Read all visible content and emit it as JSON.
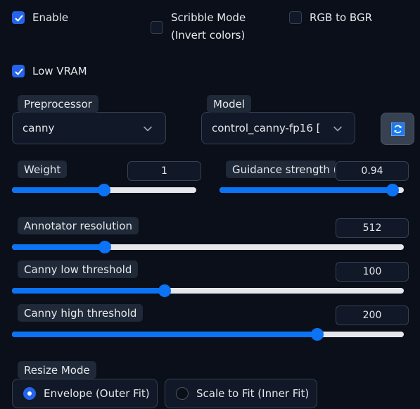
{
  "checkboxes": {
    "enable": {
      "label": "Enable",
      "checked": true
    },
    "scribble": {
      "label_line1": "Scribble Mode",
      "label_line2": "(Invert colors)",
      "checked": false
    },
    "rgb_to_bgr": {
      "label": "RGB to BGR",
      "checked": false
    },
    "low_vram": {
      "label": "Low VRAM",
      "checked": true
    }
  },
  "preprocessor": {
    "label": "Preprocessor",
    "value": "canny",
    "icon": "chevron-down-icon"
  },
  "model": {
    "label": "Model",
    "value": "control_canny-fp16 [",
    "icon": "chevron-down-icon"
  },
  "refresh": {
    "icon": "refresh-icon"
  },
  "weight": {
    "label": "Weight",
    "value": "1",
    "fraction": 0.5
  },
  "guidance": {
    "label": "Guidance strength (T",
    "value": "0.94",
    "fraction": 0.94
  },
  "annotator_resolution": {
    "label": "Annotator resolution",
    "value": "512",
    "fraction": 0.237
  },
  "canny_low": {
    "label": "Canny low threshold",
    "value": "100",
    "fraction": 0.39
  },
  "canny_high": {
    "label": "Canny high threshold",
    "value": "200",
    "fraction": 0.78
  },
  "resize_mode": {
    "label": "Resize Mode",
    "options": [
      {
        "label": "Envelope (Outer Fit)",
        "selected": true
      },
      {
        "label": "Scale to Fit (Inner Fit)",
        "selected": false
      }
    ]
  },
  "colors": {
    "accent": "#0b73f4",
    "checkbox": "#2563eb",
    "background": "#0b0f19"
  }
}
